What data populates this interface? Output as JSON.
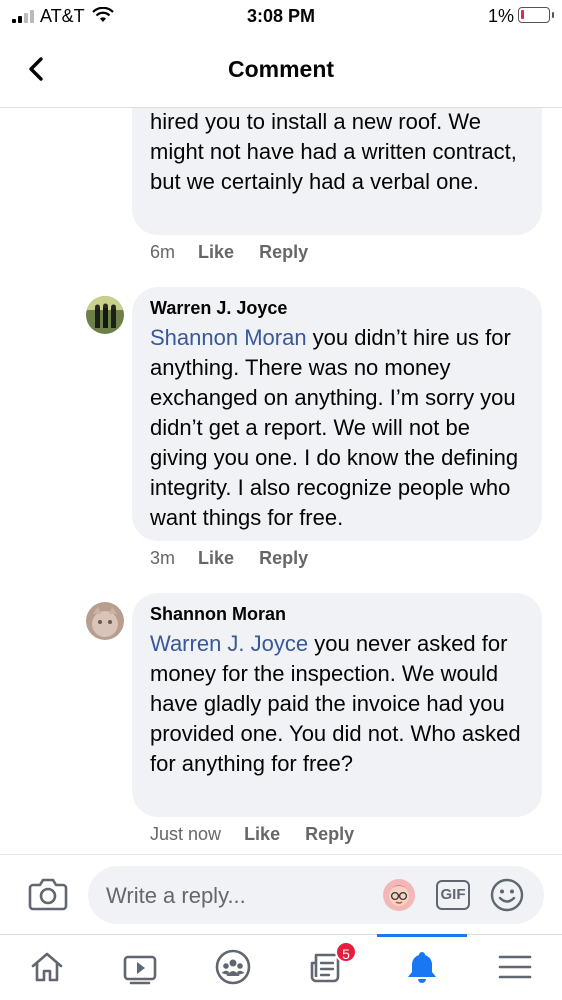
{
  "status_bar": {
    "carrier": "AT&T",
    "time": "3:08 PM",
    "battery": "1%"
  },
  "header": {
    "title": "Comment"
  },
  "comments": [
    {
      "text": "hired you to install a new roof. We might not have had a written contract, but we certainly had a verbal one.",
      "time": "6m",
      "like_label": "Like",
      "reply_label": "Reply"
    },
    {
      "author": "Warren J. Joyce",
      "mention": "Shannon Moran",
      "text": " you didn’t hire us for anything. There was no money exchanged on anything. I’m sorry you didn’t get a report. We will not be giving you one. I do know the defining integrity. I also recognize people who want things for free.",
      "time": "3m",
      "like_label": "Like",
      "reply_label": "Reply"
    },
    {
      "author": "Shannon Moran",
      "mention": "Warren J. Joyce",
      "text": " you never asked for money for the inspection. We would have gladly paid the invoice had you provided one. You did not. Who asked for anything for free?",
      "time": "Just now",
      "like_label": "Like",
      "reply_label": "Reply"
    }
  ],
  "composer": {
    "placeholder": "Write a reply...",
    "gif_label": "GIF"
  },
  "tabbar": {
    "items": [
      "home-icon",
      "watch-icon",
      "groups-icon",
      "news-icon",
      "notifications-icon",
      "menu-icon"
    ],
    "news_badge": "5",
    "active": "notifications",
    "accent": "#1877f2"
  }
}
